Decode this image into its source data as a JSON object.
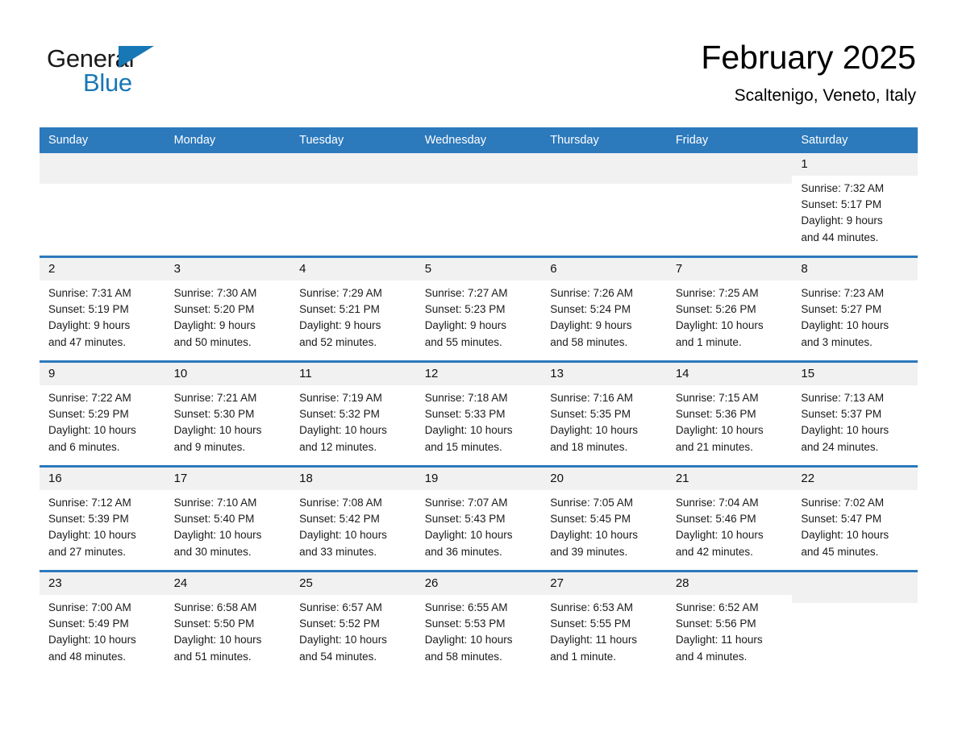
{
  "brand": {
    "name_part1": "General",
    "name_part2": "Blue",
    "accent_color": "#1877b5"
  },
  "header": {
    "title": "February 2025",
    "location": "Scaltenigo, Veneto, Italy"
  },
  "theme": {
    "header_row_color": "#2c79bc",
    "daynum_band_color": "#f1f1f1",
    "cell_background": "#ffffff",
    "text_color": "#1a1a1a"
  },
  "weekdays": [
    "Sunday",
    "Monday",
    "Tuesday",
    "Wednesday",
    "Thursday",
    "Friday",
    "Saturday"
  ],
  "weeks": [
    [
      {
        "day": "",
        "sunrise": "",
        "sunset": "",
        "daylight_line1": "",
        "daylight_line2": ""
      },
      {
        "day": "",
        "sunrise": "",
        "sunset": "",
        "daylight_line1": "",
        "daylight_line2": ""
      },
      {
        "day": "",
        "sunrise": "",
        "sunset": "",
        "daylight_line1": "",
        "daylight_line2": ""
      },
      {
        "day": "",
        "sunrise": "",
        "sunset": "",
        "daylight_line1": "",
        "daylight_line2": ""
      },
      {
        "day": "",
        "sunrise": "",
        "sunset": "",
        "daylight_line1": "",
        "daylight_line2": ""
      },
      {
        "day": "",
        "sunrise": "",
        "sunset": "",
        "daylight_line1": "",
        "daylight_line2": ""
      },
      {
        "day": "1",
        "sunrise": "Sunrise: 7:32 AM",
        "sunset": "Sunset: 5:17 PM",
        "daylight_line1": "Daylight: 9 hours",
        "daylight_line2": "and 44 minutes."
      }
    ],
    [
      {
        "day": "2",
        "sunrise": "Sunrise: 7:31 AM",
        "sunset": "Sunset: 5:19 PM",
        "daylight_line1": "Daylight: 9 hours",
        "daylight_line2": "and 47 minutes."
      },
      {
        "day": "3",
        "sunrise": "Sunrise: 7:30 AM",
        "sunset": "Sunset: 5:20 PM",
        "daylight_line1": "Daylight: 9 hours",
        "daylight_line2": "and 50 minutes."
      },
      {
        "day": "4",
        "sunrise": "Sunrise: 7:29 AM",
        "sunset": "Sunset: 5:21 PM",
        "daylight_line1": "Daylight: 9 hours",
        "daylight_line2": "and 52 minutes."
      },
      {
        "day": "5",
        "sunrise": "Sunrise: 7:27 AM",
        "sunset": "Sunset: 5:23 PM",
        "daylight_line1": "Daylight: 9 hours",
        "daylight_line2": "and 55 minutes."
      },
      {
        "day": "6",
        "sunrise": "Sunrise: 7:26 AM",
        "sunset": "Sunset: 5:24 PM",
        "daylight_line1": "Daylight: 9 hours",
        "daylight_line2": "and 58 minutes."
      },
      {
        "day": "7",
        "sunrise": "Sunrise: 7:25 AM",
        "sunset": "Sunset: 5:26 PM",
        "daylight_line1": "Daylight: 10 hours",
        "daylight_line2": "and 1 minute."
      },
      {
        "day": "8",
        "sunrise": "Sunrise: 7:23 AM",
        "sunset": "Sunset: 5:27 PM",
        "daylight_line1": "Daylight: 10 hours",
        "daylight_line2": "and 3 minutes."
      }
    ],
    [
      {
        "day": "9",
        "sunrise": "Sunrise: 7:22 AM",
        "sunset": "Sunset: 5:29 PM",
        "daylight_line1": "Daylight: 10 hours",
        "daylight_line2": "and 6 minutes."
      },
      {
        "day": "10",
        "sunrise": "Sunrise: 7:21 AM",
        "sunset": "Sunset: 5:30 PM",
        "daylight_line1": "Daylight: 10 hours",
        "daylight_line2": "and 9 minutes."
      },
      {
        "day": "11",
        "sunrise": "Sunrise: 7:19 AM",
        "sunset": "Sunset: 5:32 PM",
        "daylight_line1": "Daylight: 10 hours",
        "daylight_line2": "and 12 minutes."
      },
      {
        "day": "12",
        "sunrise": "Sunrise: 7:18 AM",
        "sunset": "Sunset: 5:33 PM",
        "daylight_line1": "Daylight: 10 hours",
        "daylight_line2": "and 15 minutes."
      },
      {
        "day": "13",
        "sunrise": "Sunrise: 7:16 AM",
        "sunset": "Sunset: 5:35 PM",
        "daylight_line1": "Daylight: 10 hours",
        "daylight_line2": "and 18 minutes."
      },
      {
        "day": "14",
        "sunrise": "Sunrise: 7:15 AM",
        "sunset": "Sunset: 5:36 PM",
        "daylight_line1": "Daylight: 10 hours",
        "daylight_line2": "and 21 minutes."
      },
      {
        "day": "15",
        "sunrise": "Sunrise: 7:13 AM",
        "sunset": "Sunset: 5:37 PM",
        "daylight_line1": "Daylight: 10 hours",
        "daylight_line2": "and 24 minutes."
      }
    ],
    [
      {
        "day": "16",
        "sunrise": "Sunrise: 7:12 AM",
        "sunset": "Sunset: 5:39 PM",
        "daylight_line1": "Daylight: 10 hours",
        "daylight_line2": "and 27 minutes."
      },
      {
        "day": "17",
        "sunrise": "Sunrise: 7:10 AM",
        "sunset": "Sunset: 5:40 PM",
        "daylight_line1": "Daylight: 10 hours",
        "daylight_line2": "and 30 minutes."
      },
      {
        "day": "18",
        "sunrise": "Sunrise: 7:08 AM",
        "sunset": "Sunset: 5:42 PM",
        "daylight_line1": "Daylight: 10 hours",
        "daylight_line2": "and 33 minutes."
      },
      {
        "day": "19",
        "sunrise": "Sunrise: 7:07 AM",
        "sunset": "Sunset: 5:43 PM",
        "daylight_line1": "Daylight: 10 hours",
        "daylight_line2": "and 36 minutes."
      },
      {
        "day": "20",
        "sunrise": "Sunrise: 7:05 AM",
        "sunset": "Sunset: 5:45 PM",
        "daylight_line1": "Daylight: 10 hours",
        "daylight_line2": "and 39 minutes."
      },
      {
        "day": "21",
        "sunrise": "Sunrise: 7:04 AM",
        "sunset": "Sunset: 5:46 PM",
        "daylight_line1": "Daylight: 10 hours",
        "daylight_line2": "and 42 minutes."
      },
      {
        "day": "22",
        "sunrise": "Sunrise: 7:02 AM",
        "sunset": "Sunset: 5:47 PM",
        "daylight_line1": "Daylight: 10 hours",
        "daylight_line2": "and 45 minutes."
      }
    ],
    [
      {
        "day": "23",
        "sunrise": "Sunrise: 7:00 AM",
        "sunset": "Sunset: 5:49 PM",
        "daylight_line1": "Daylight: 10 hours",
        "daylight_line2": "and 48 minutes."
      },
      {
        "day": "24",
        "sunrise": "Sunrise: 6:58 AM",
        "sunset": "Sunset: 5:50 PM",
        "daylight_line1": "Daylight: 10 hours",
        "daylight_line2": "and 51 minutes."
      },
      {
        "day": "25",
        "sunrise": "Sunrise: 6:57 AM",
        "sunset": "Sunset: 5:52 PM",
        "daylight_line1": "Daylight: 10 hours",
        "daylight_line2": "and 54 minutes."
      },
      {
        "day": "26",
        "sunrise": "Sunrise: 6:55 AM",
        "sunset": "Sunset: 5:53 PM",
        "daylight_line1": "Daylight: 10 hours",
        "daylight_line2": "and 58 minutes."
      },
      {
        "day": "27",
        "sunrise": "Sunrise: 6:53 AM",
        "sunset": "Sunset: 5:55 PM",
        "daylight_line1": "Daylight: 11 hours",
        "daylight_line2": "and 1 minute."
      },
      {
        "day": "28",
        "sunrise": "Sunrise: 6:52 AM",
        "sunset": "Sunset: 5:56 PM",
        "daylight_line1": "Daylight: 11 hours",
        "daylight_line2": "and 4 minutes."
      },
      {
        "day": "",
        "sunrise": "",
        "sunset": "",
        "daylight_line1": "",
        "daylight_line2": ""
      }
    ]
  ]
}
